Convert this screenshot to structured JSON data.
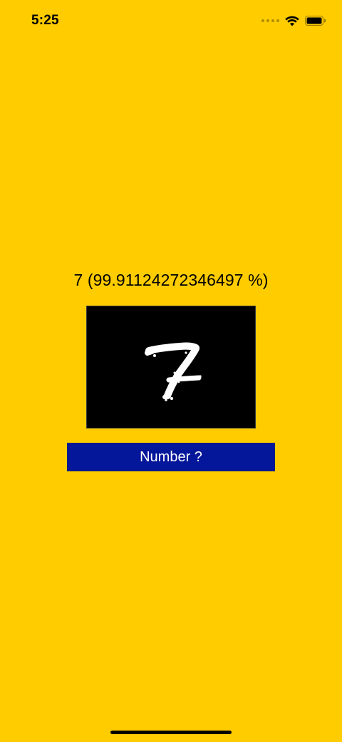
{
  "status_bar": {
    "time": "5:25",
    "icons": [
      "cellular-dots-icon",
      "wifi-icon",
      "battery-icon"
    ]
  },
  "prediction": {
    "text": "7 (99.91124272346497 %)"
  },
  "canvas": {
    "description_icon": "handwritten-digit-drawing",
    "background_color": "#000000",
    "stroke_color": "#FFFFFF"
  },
  "predict_button": {
    "label": "Number ?"
  },
  "colors": {
    "background": "#FFCC00",
    "button": "#04169A",
    "button_text": "#FFFFFF"
  }
}
